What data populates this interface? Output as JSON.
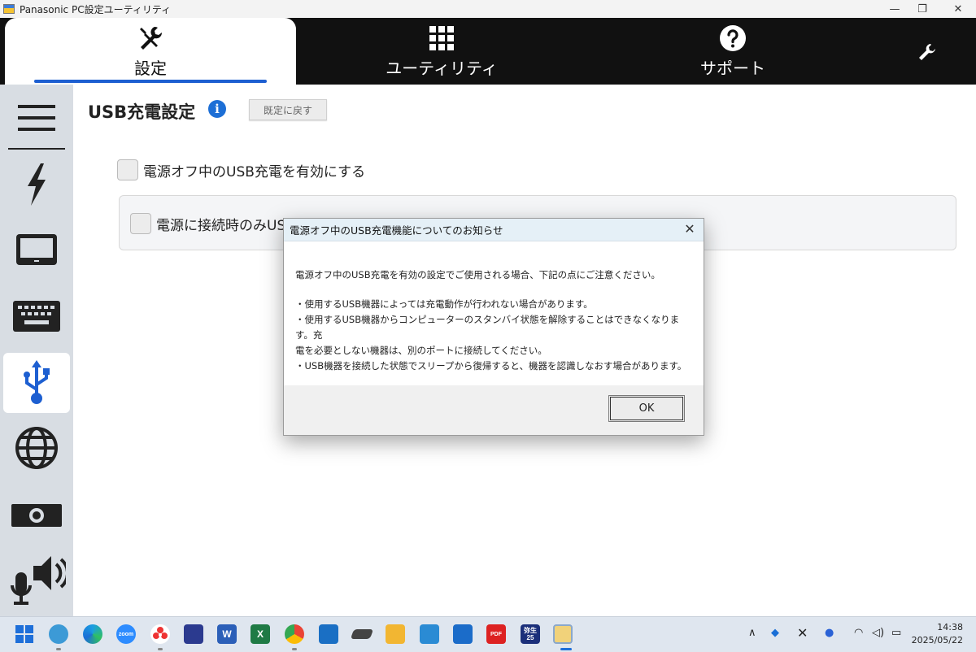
{
  "window": {
    "title": "Panasonic PC設定ユーティリティ",
    "minimize": "—",
    "restore": "❐",
    "close": "✕"
  },
  "tabs": [
    {
      "label": "設定",
      "icon": "tools-icon",
      "active": true
    },
    {
      "label": "ユーティリティ",
      "icon": "grid-icon",
      "active": false
    },
    {
      "label": "サポート",
      "icon": "help-circle-icon",
      "active": false
    }
  ],
  "sidebar": {
    "items": [
      {
        "icon": "menu-icon"
      },
      {
        "icon": "power-bolt-icon"
      },
      {
        "icon": "display-icon"
      },
      {
        "icon": "keyboard-icon"
      },
      {
        "icon": "usb-icon",
        "active": true
      },
      {
        "icon": "network-globe-icon"
      },
      {
        "icon": "camera-icon"
      },
      {
        "icon": "audio-icon"
      }
    ]
  },
  "main": {
    "title": "USB充電設定",
    "reset_label": "既定に戻す",
    "options": [
      {
        "label": "電源オフ中のUSB充電を有効にする",
        "checked": false
      },
      {
        "label": "電源に接続時のみUSB機器を充電する",
        "checked": false
      }
    ]
  },
  "dialog": {
    "title": "電源オフ中のUSB充電機能についてのお知らせ",
    "intro": "電源オフ中のUSB充電を有効の設定でご使用される場合、下記の点にご注意ください。",
    "bullets": [
      "・使用するUSB機器によっては充電動作が行われない場合があります。",
      "・使用するUSB機器からコンピューターのスタンバイ状態を解除することはできなくなります。充",
      "電を必要としない機器は、別のポートに接続してください。",
      "・USB機器を接続した状態でスリープから復帰すると、機器を認識しなおす場合があります。"
    ],
    "ok_label": "OK",
    "close_glyph": "✕"
  },
  "taskbar": {
    "zoom_label": "zoom",
    "word_label": "W",
    "excel_label": "X",
    "pdf_label": "PDF",
    "yayoi_label": "弥生\n25",
    "clock_time": "14:38",
    "clock_date": "2025/05/22"
  },
  "colors": {
    "accent": "#1d5fd1",
    "nav_bg": "#111111",
    "sidebar_bg": "#d8dde3",
    "dialog_title_bg": "#e5f0f7"
  }
}
